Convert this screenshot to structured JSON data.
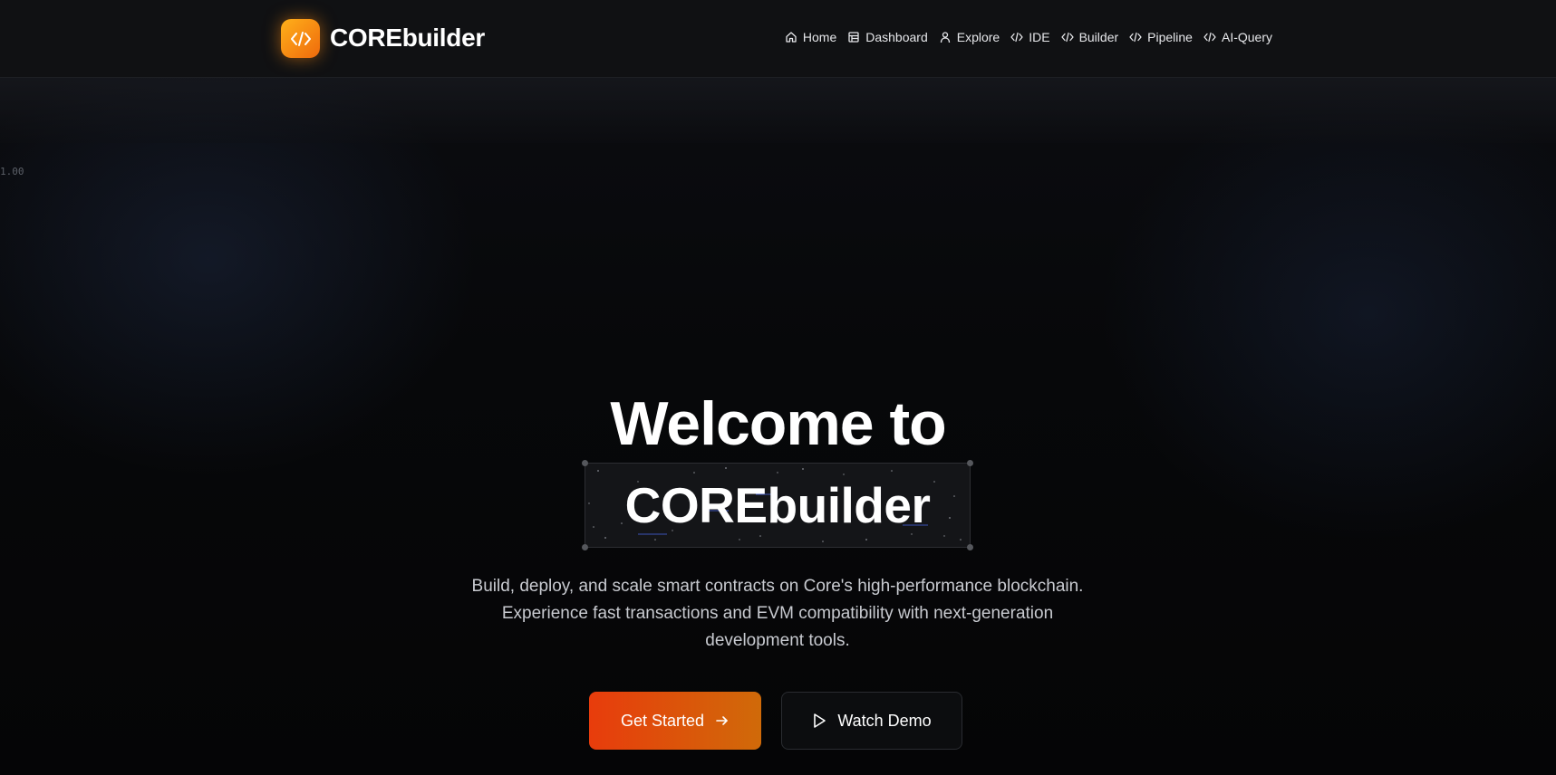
{
  "header": {
    "logo_text": "COREbuilder",
    "nav": [
      {
        "label": "Home",
        "icon": "home-icon"
      },
      {
        "label": "Dashboard",
        "icon": "dashboard-icon"
      },
      {
        "label": "Explore",
        "icon": "user-icon"
      },
      {
        "label": "IDE",
        "icon": "code-icon"
      },
      {
        "label": "Builder",
        "icon": "code-icon"
      },
      {
        "label": "Pipeline",
        "icon": "code-icon"
      },
      {
        "label": "AI-Query",
        "icon": "code-icon"
      }
    ]
  },
  "corner_readout": "1.00",
  "hero": {
    "title_line1": "Welcome to",
    "title_line2": "COREbuilder",
    "subtitle_lines": [
      "Build, deploy, and scale smart contracts on Core's high-performance blockchain.",
      "Experience fast transactions and EVM compatibility with next-generation",
      "development tools."
    ]
  },
  "buttons": {
    "primary_label": "Get Started",
    "secondary_label": "Watch Demo"
  },
  "colors": {
    "accent_start": "#e83c0c",
    "accent_end": "#d06a09",
    "logo_gradient_start": "#ffb01a",
    "logo_gradient_end": "#ef6a0c",
    "background": "#050506"
  }
}
